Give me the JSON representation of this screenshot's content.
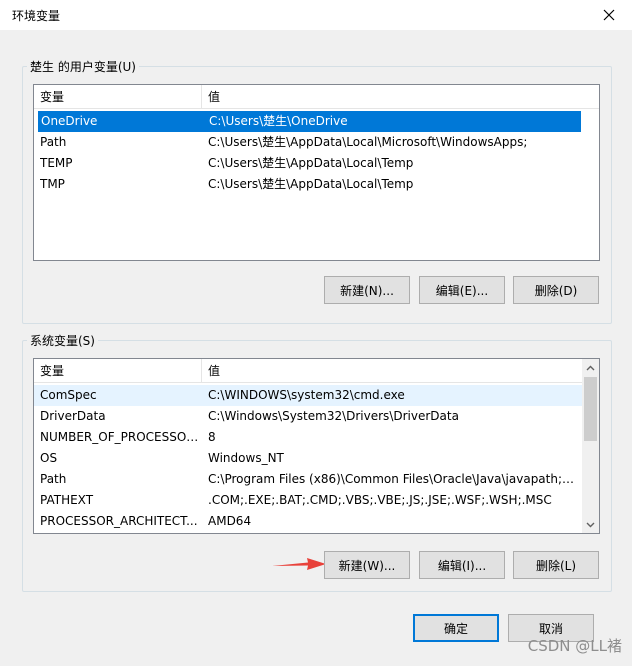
{
  "window": {
    "title": "环境变量"
  },
  "user_group": {
    "label": "楚生 的用户变量(U)",
    "columns": [
      "变量",
      "值"
    ],
    "rows": [
      {
        "name": "OneDrive",
        "value": "C:\\Users\\楚生\\OneDrive",
        "selected": true
      },
      {
        "name": "Path",
        "value": "C:\\Users\\楚生\\AppData\\Local\\Microsoft\\WindowsApps;"
      },
      {
        "name": "TEMP",
        "value": "C:\\Users\\楚生\\AppData\\Local\\Temp"
      },
      {
        "name": "TMP",
        "value": "C:\\Users\\楚生\\AppData\\Local\\Temp"
      }
    ],
    "buttons": {
      "new": "新建(N)...",
      "edit": "编辑(E)...",
      "delete": "删除(D)"
    }
  },
  "system_group": {
    "label": "系统变量(S)",
    "columns": [
      "变量",
      "值"
    ],
    "rows": [
      {
        "name": "ComSpec",
        "value": "C:\\WINDOWS\\system32\\cmd.exe"
      },
      {
        "name": "DriverData",
        "value": "C:\\Windows\\System32\\Drivers\\DriverData"
      },
      {
        "name": "NUMBER_OF_PROCESSORS",
        "value": "8"
      },
      {
        "name": "OS",
        "value": "Windows_NT"
      },
      {
        "name": "Path",
        "value": "C:\\Program Files (x86)\\Common Files\\Oracle\\Java\\javapath;C:..."
      },
      {
        "name": "PATHEXT",
        "value": ".COM;.EXE;.BAT;.CMD;.VBS;.VBE;.JS;.JSE;.WSF;.WSH;.MSC"
      },
      {
        "name": "PROCESSOR_ARCHITECT...",
        "value": "AMD64"
      }
    ],
    "buttons": {
      "new": "新建(W)...",
      "edit": "编辑(I)...",
      "delete": "删除(L)"
    }
  },
  "footer": {
    "ok": "确定",
    "cancel": "取消"
  },
  "watermark": "CSDN @LL褚",
  "colors": {
    "selection": "#0078d7",
    "annotation_arrow": "#e8413a"
  },
  "icons": {
    "close": "close-icon",
    "scroll_up": "chevron-up-icon",
    "scroll_down": "chevron-down-icon",
    "arrow": "red-arrow-icon"
  }
}
